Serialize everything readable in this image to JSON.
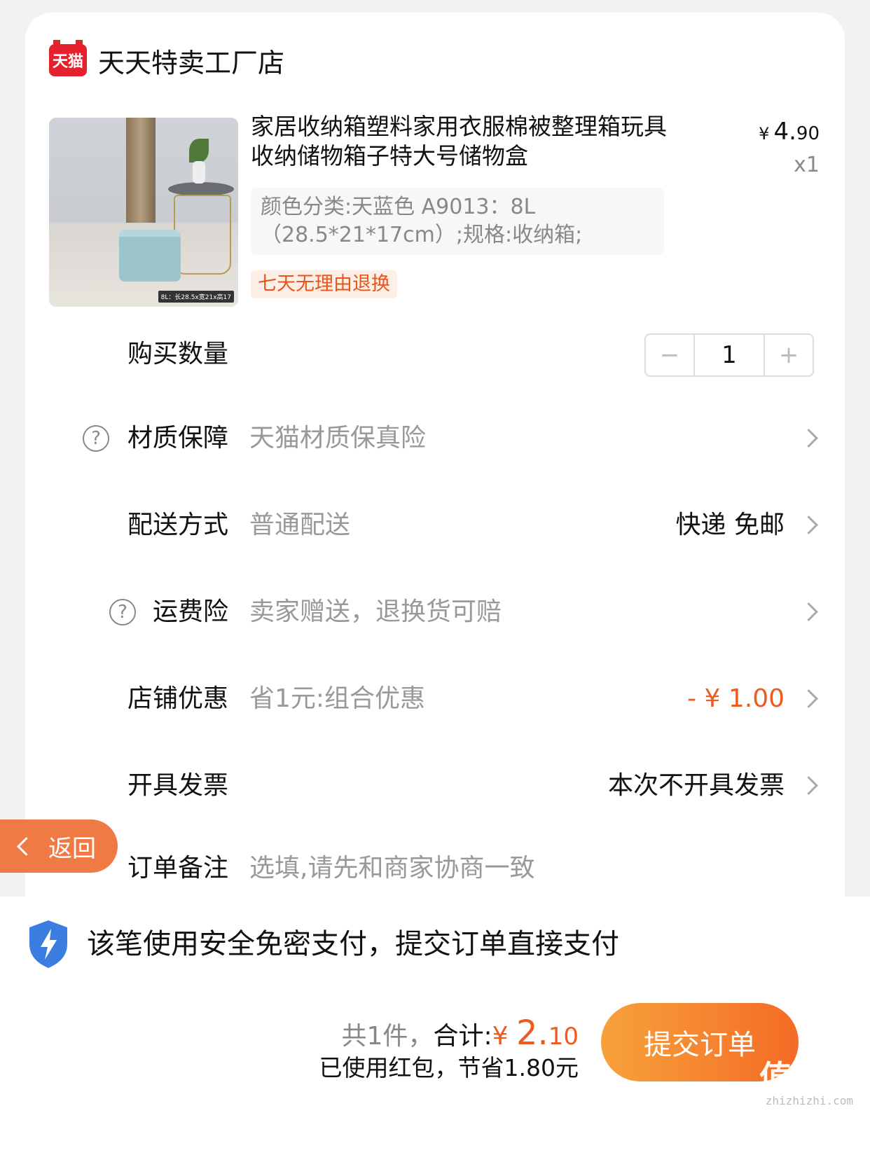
{
  "shop": {
    "logo_text": "天猫",
    "name": "天天特卖工厂店"
  },
  "product": {
    "thumb_caption": "8L：长28.5x宽21x高17",
    "title": "家居收纳箱塑料家用衣服棉被整理箱玩具收纳储物箱子特大号储物盒",
    "price_currency": "¥",
    "price_main": "4.",
    "price_cents": "90",
    "quantity_label": "x1",
    "sku": "颜色分类:天蓝色 A9013：8L（28.5*21*17cm）;规格:收纳箱;",
    "badge": "七天无理由退换"
  },
  "quantity": {
    "label": "购买数量",
    "minus": "−",
    "value": "1",
    "plus": "+"
  },
  "rows": {
    "material": {
      "label": "材质保障",
      "value": "天猫材质保真险"
    },
    "delivery": {
      "label": "配送方式",
      "value": "普通配送",
      "right": "快递 免邮"
    },
    "shipping_insurance": {
      "label": "运费险",
      "value": "卖家赠送，退换货可赔"
    },
    "store_discount": {
      "label": "店铺优惠",
      "value": "省1元:组合优惠",
      "right": "- ¥ 1.00"
    },
    "invoice": {
      "label": "开具发票",
      "right": "本次不开具发票"
    },
    "remark": {
      "label": "订单备注",
      "placeholder": "选填,请先和商家协商一致"
    }
  },
  "back_button": {
    "label": "返回"
  },
  "footer": {
    "secure_text": "该笔使用安全免密支付，提交订单直接支付",
    "count_text": "共1件，",
    "total_label": "合计:",
    "total_currency": "¥ ",
    "total_main": "2.",
    "total_cents": "10",
    "savings_text": "已使用红包，节省1.80元",
    "submit_label": "提交订单"
  },
  "watermark": {
    "text": "值值值",
    "url": "zhizhizhi.com"
  },
  "colors": {
    "accent": "#ef5a1f",
    "tmall_red": "#e5212d",
    "button_start": "#f7a23c",
    "button_end": "#f46b25"
  },
  "icons": [
    "tmall-logo",
    "help-icon",
    "chevron-right-icon",
    "shield-lightning-icon",
    "back-arrow-icon"
  ]
}
